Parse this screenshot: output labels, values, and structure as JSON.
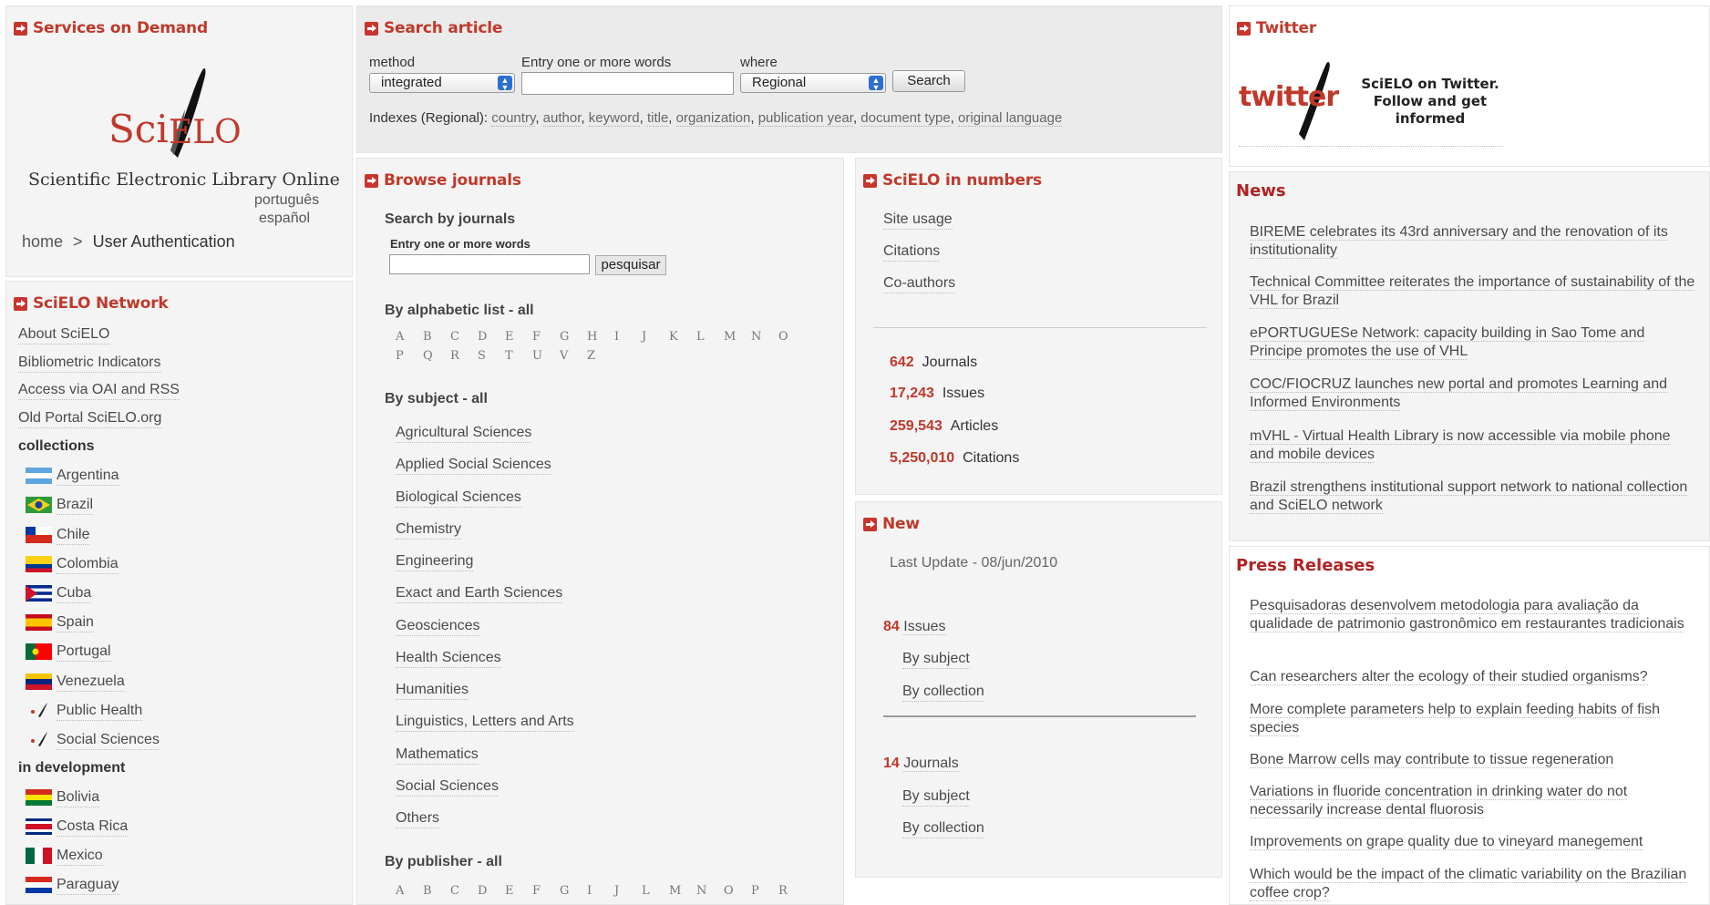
{
  "services": {
    "title": "Services on Demand",
    "logo_text_sci": "Sci",
    "logo_text_elo": "ELO",
    "logo_subtitle": "Scientific Electronic Library Online",
    "lang_pt": "português",
    "lang_es": "español",
    "breadcrumb_home": "home",
    "breadcrumb_sep": ">",
    "breadcrumb_current": "User Authentication"
  },
  "search": {
    "title": "Search article",
    "method_label": "method",
    "method_value": "integrated",
    "words_label": "Entry one or more words",
    "where_label": "where",
    "where_value": "Regional",
    "button": "Search",
    "indexes_label": "Indexes (Regional):",
    "indexes": [
      "country",
      "author",
      "keyword",
      "title",
      "organization",
      "publication year",
      "document type",
      "original language"
    ]
  },
  "twitter": {
    "title": "Twitter",
    "logo_text": "twitter",
    "line1": "SciELO on Twitter.",
    "line2": "Follow and get",
    "line3": "informed"
  },
  "network": {
    "title": "SciELO Network",
    "links": [
      "About SciELO",
      "Bibliometric Indicators",
      "Access via OAI and RSS",
      "Old Portal SciELO.org"
    ],
    "collections_heading": "collections",
    "collections": [
      "Argentina",
      "Brazil",
      "Chile",
      "Colombia",
      "Cuba",
      "Spain",
      "Portugal",
      "Venezuela",
      "Public Health",
      "Social Sciences"
    ],
    "development_heading": "in development",
    "development": [
      "Bolivia",
      "Costa Rica",
      "Mexico",
      "Paraguay"
    ]
  },
  "browse": {
    "title": "Browse journals",
    "search_heading": "Search by journals",
    "entry_label": "Entry one or more words",
    "search_button": "pesquisar",
    "alpha_heading": "By alphabetic list - all",
    "alpha_row1": [
      "A",
      "B",
      "C",
      "D",
      "E",
      "F",
      "G",
      "H",
      "I",
      "J",
      "K",
      "L",
      "M",
      "N",
      "O"
    ],
    "alpha_row2": [
      "P",
      "Q",
      "R",
      "S",
      "T",
      "U",
      "V",
      "Z"
    ],
    "subject_heading": "By subject - all",
    "subjects": [
      "Agricultural Sciences",
      "Applied Social Sciences",
      "Biological Sciences",
      "Chemistry",
      "Engineering",
      "Exact and Earth Sciences",
      "Geosciences",
      "Health Sciences",
      "Humanities",
      "Linguistics, Letters and Arts",
      "Mathematics",
      "Social Sciences",
      "Others"
    ],
    "publisher_heading": "By publisher - all",
    "publisher_alpha": [
      "A",
      "B",
      "C",
      "D",
      "E",
      "F",
      "G",
      "I",
      "J",
      "L",
      "M",
      "N",
      "O",
      "P",
      "R"
    ]
  },
  "numbers": {
    "title": "SciELO in numbers",
    "links": [
      "Site usage",
      "Citations",
      "Co-authors"
    ],
    "stats": [
      {
        "value": "642",
        "label": "Journals"
      },
      {
        "value": "17,243",
        "label": "Issues"
      },
      {
        "value": "259,543",
        "label": "Articles"
      },
      {
        "value": "5,250,010",
        "label": "Citations"
      }
    ]
  },
  "new": {
    "title": "New",
    "last_update": "Last Update - 08/jun/2010",
    "issues_count": "84",
    "issues_label": "Issues",
    "journals_count": "14",
    "journals_label": "Journals",
    "by_subject": "By subject",
    "by_collection": "By collection"
  },
  "news": {
    "title": "News",
    "items": [
      "BIREME celebrates its 43rd anniversary and the renovation of its institutionality",
      "Technical Committee reiterates the importance of sustainability of the VHL for Brazil",
      "ePORTUGUESe Network: capacity building in Sao Tome and Principe promotes the use of VHL",
      "COC/FIOCRUZ launches new portal and promotes Learning and Informed Environments",
      "mVHL - Virtual Health Library is now accessible via mobile phone and mobile devices",
      "Brazil strengthens institutional support network to national collection and SciELO network"
    ]
  },
  "press": {
    "title": "Press Releases",
    "items": [
      "Pesquisadoras desenvolvem metodologia para avaliação da qualidade de patrimonio gastronômico em restaurantes tradicionais",
      "Can researchers alter the ecology of their studied organisms?",
      "More complete parameters help to explain feeding habits of fish species",
      "Bone Marrow cells may contribute to tissue regeneration",
      "Variations in fluoride concentration in drinking water do not necessarily increase dental fluorosis",
      "Improvements on grape quality due to vineyard manegement",
      "Which would be the impact of the climatic variability on the Brazilian coffee crop?"
    ]
  }
}
